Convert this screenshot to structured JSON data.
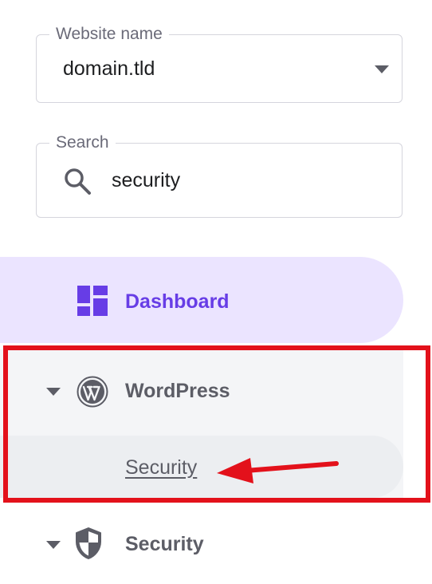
{
  "website_field": {
    "label": "Website name",
    "value": "domain.tld"
  },
  "search_field": {
    "label": "Search",
    "value": "security"
  },
  "nav": {
    "dashboard": {
      "label": "Dashboard",
      "icon": "dashboard-icon",
      "active": true
    },
    "wordpress": {
      "label": "WordPress",
      "icon": "wordpress-icon",
      "expanded": true,
      "children": [
        {
          "label": "Security"
        }
      ]
    },
    "security": {
      "label": "Security",
      "icon": "shield-icon"
    }
  },
  "colors": {
    "accent": "#673de6",
    "active_bg": "#ebe4ff",
    "highlight": "#e3111b",
    "text_muted": "#5c5d66"
  }
}
